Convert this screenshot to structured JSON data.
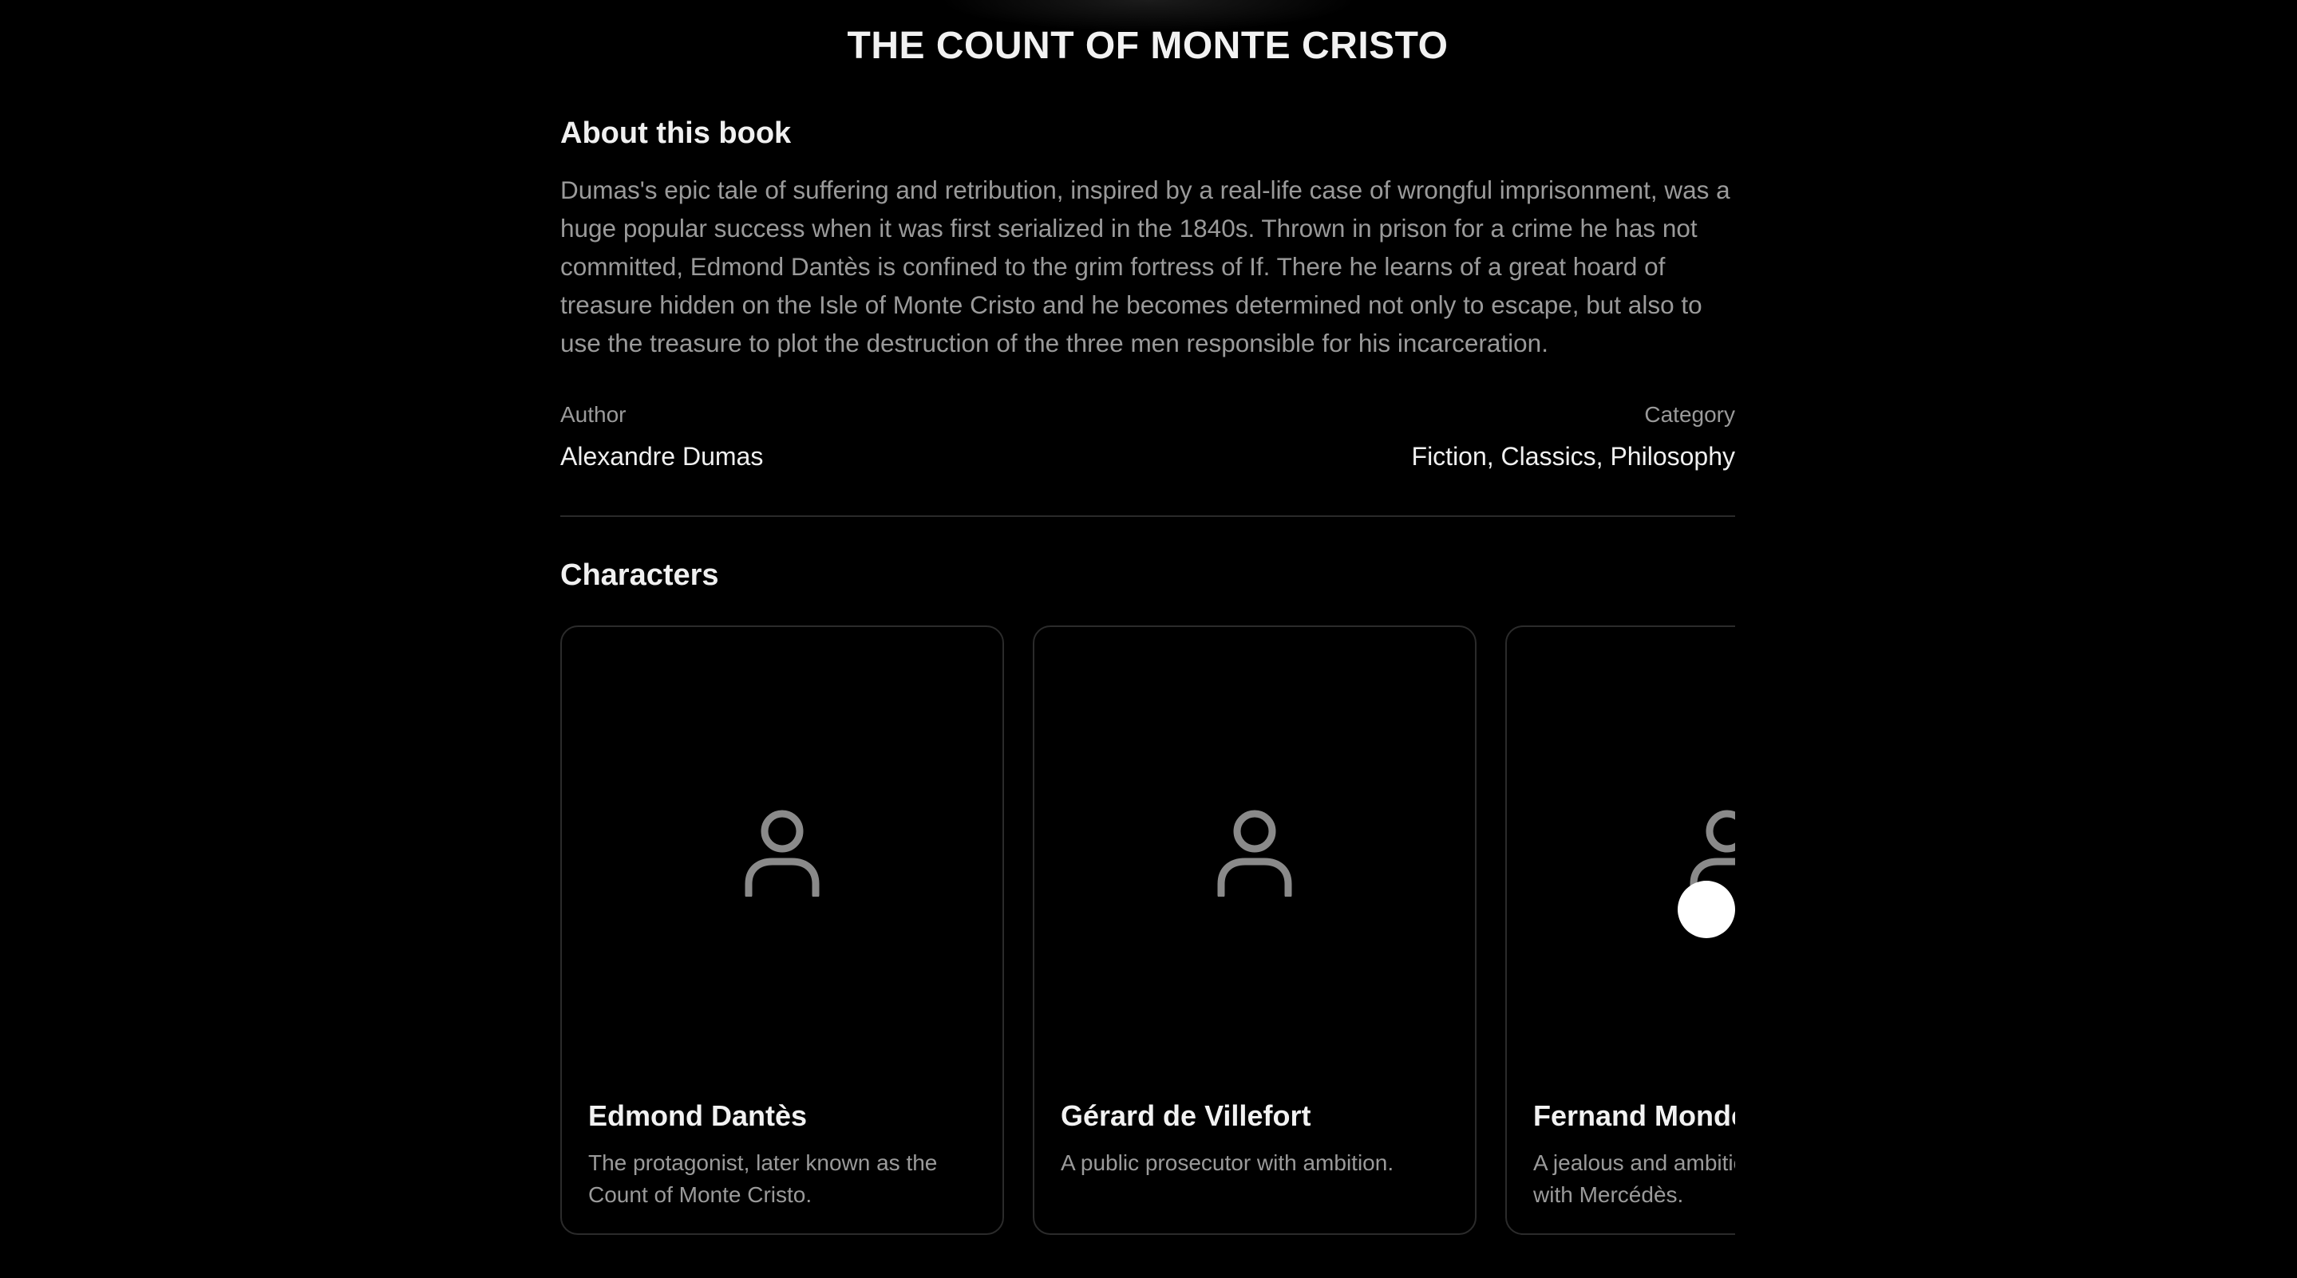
{
  "book": {
    "title": "THE COUNT OF MONTE CRISTO"
  },
  "about": {
    "heading": "About this book",
    "description": "Dumas's epic tale of suffering and retribution, inspired by a real-life case of wrongful imprisonment, was a huge popular success when it was first serialized in the 1840s. Thrown in prison for a crime he has not committed, Edmond Dantès is confined to the grim fortress of If. There he learns of a great hoard of treasure hidden on the Isle of Monte Cristo and he becomes determined not only to escape, but also to use the treasure to plot the destruction of the three men responsible for his incarceration."
  },
  "meta": {
    "author_label": "Author",
    "author_value": "Alexandre Dumas",
    "category_label": "Category",
    "category_value": "Fiction, Classics, Philosophy"
  },
  "characters": {
    "heading": "Characters",
    "items": [
      {
        "name": "Edmond Dantès",
        "description": "The protagonist, later known as the Count of Monte Cristo.",
        "icon": "person-icon"
      },
      {
        "name": "Gérard de Villefort",
        "description": "A public prosecutor with ambition.",
        "icon": "person-icon"
      },
      {
        "name": "Fernand Mondego",
        "description": "A jealous and ambitious rival in love with Mercédès.",
        "icon": "person-icon"
      }
    ]
  },
  "colors": {
    "background": "#000000",
    "text_primary": "#f0f0f0",
    "text_secondary": "#9a9a9a",
    "border": "#2b2b2b",
    "icon": "#8a8a8a"
  }
}
